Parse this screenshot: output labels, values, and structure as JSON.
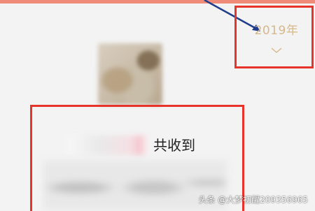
{
  "header": {
    "year_selector": {
      "label": "2019年",
      "icon": "chevron-down-icon"
    }
  },
  "summary": {
    "received_text": "共收到"
  },
  "watermark": {
    "text": "头条 @大梦初醒209356965"
  },
  "colors": {
    "top_bar": "#f08b7a",
    "year_label": "#d6b98a",
    "annotation_red": "#e8332b",
    "background": "#f3f3f3"
  }
}
